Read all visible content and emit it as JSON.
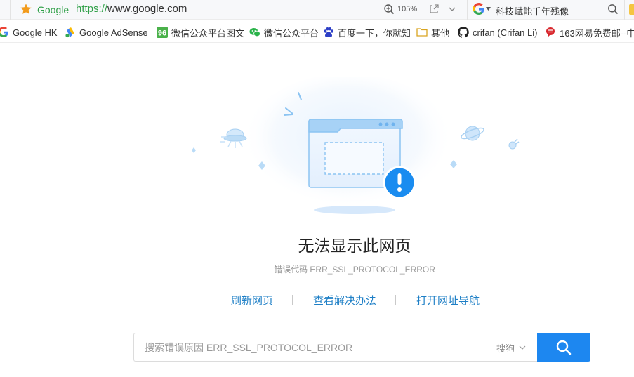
{
  "addressbar": {
    "site_name": "Google",
    "url_scheme": "https://",
    "url_rest": "www.google.com",
    "zoom": "105%",
    "search_engine_text": "科技赋能千年残像"
  },
  "bookmarks": [
    {
      "label": "Google HK",
      "icon": "google-icon"
    },
    {
      "label": "Google AdSense",
      "icon": "adsense-icon"
    },
    {
      "label": "微信公众平台图文",
      "icon": "96-icon"
    },
    {
      "label": "微信公众平台",
      "icon": "wechat-icon"
    },
    {
      "label": "百度一下，你就知",
      "icon": "baidu-icon"
    },
    {
      "label": "其他",
      "icon": "folder-icon"
    },
    {
      "label": "crifan (Crifan Li)",
      "icon": "github-icon"
    },
    {
      "label": "163网易免费邮--中",
      "icon": "netease-icon"
    }
  ],
  "error_page": {
    "title": "无法显示此网页",
    "error_label": "错误代码",
    "error_code": "ERR_SSL_PROTOCOL_ERROR",
    "links": [
      "刷新网页",
      "查看解决办法",
      "打开网址导航"
    ],
    "search_placeholder": "搜索错误原因 ERR_SSL_PROTOCOL_ERROR",
    "search_engine": "搜狗"
  },
  "colors": {
    "url_green": "#2e9f46",
    "link_blue": "#1e7fc6",
    "button_blue": "#1d87f0",
    "alert_blue": "#1a8cf0"
  }
}
